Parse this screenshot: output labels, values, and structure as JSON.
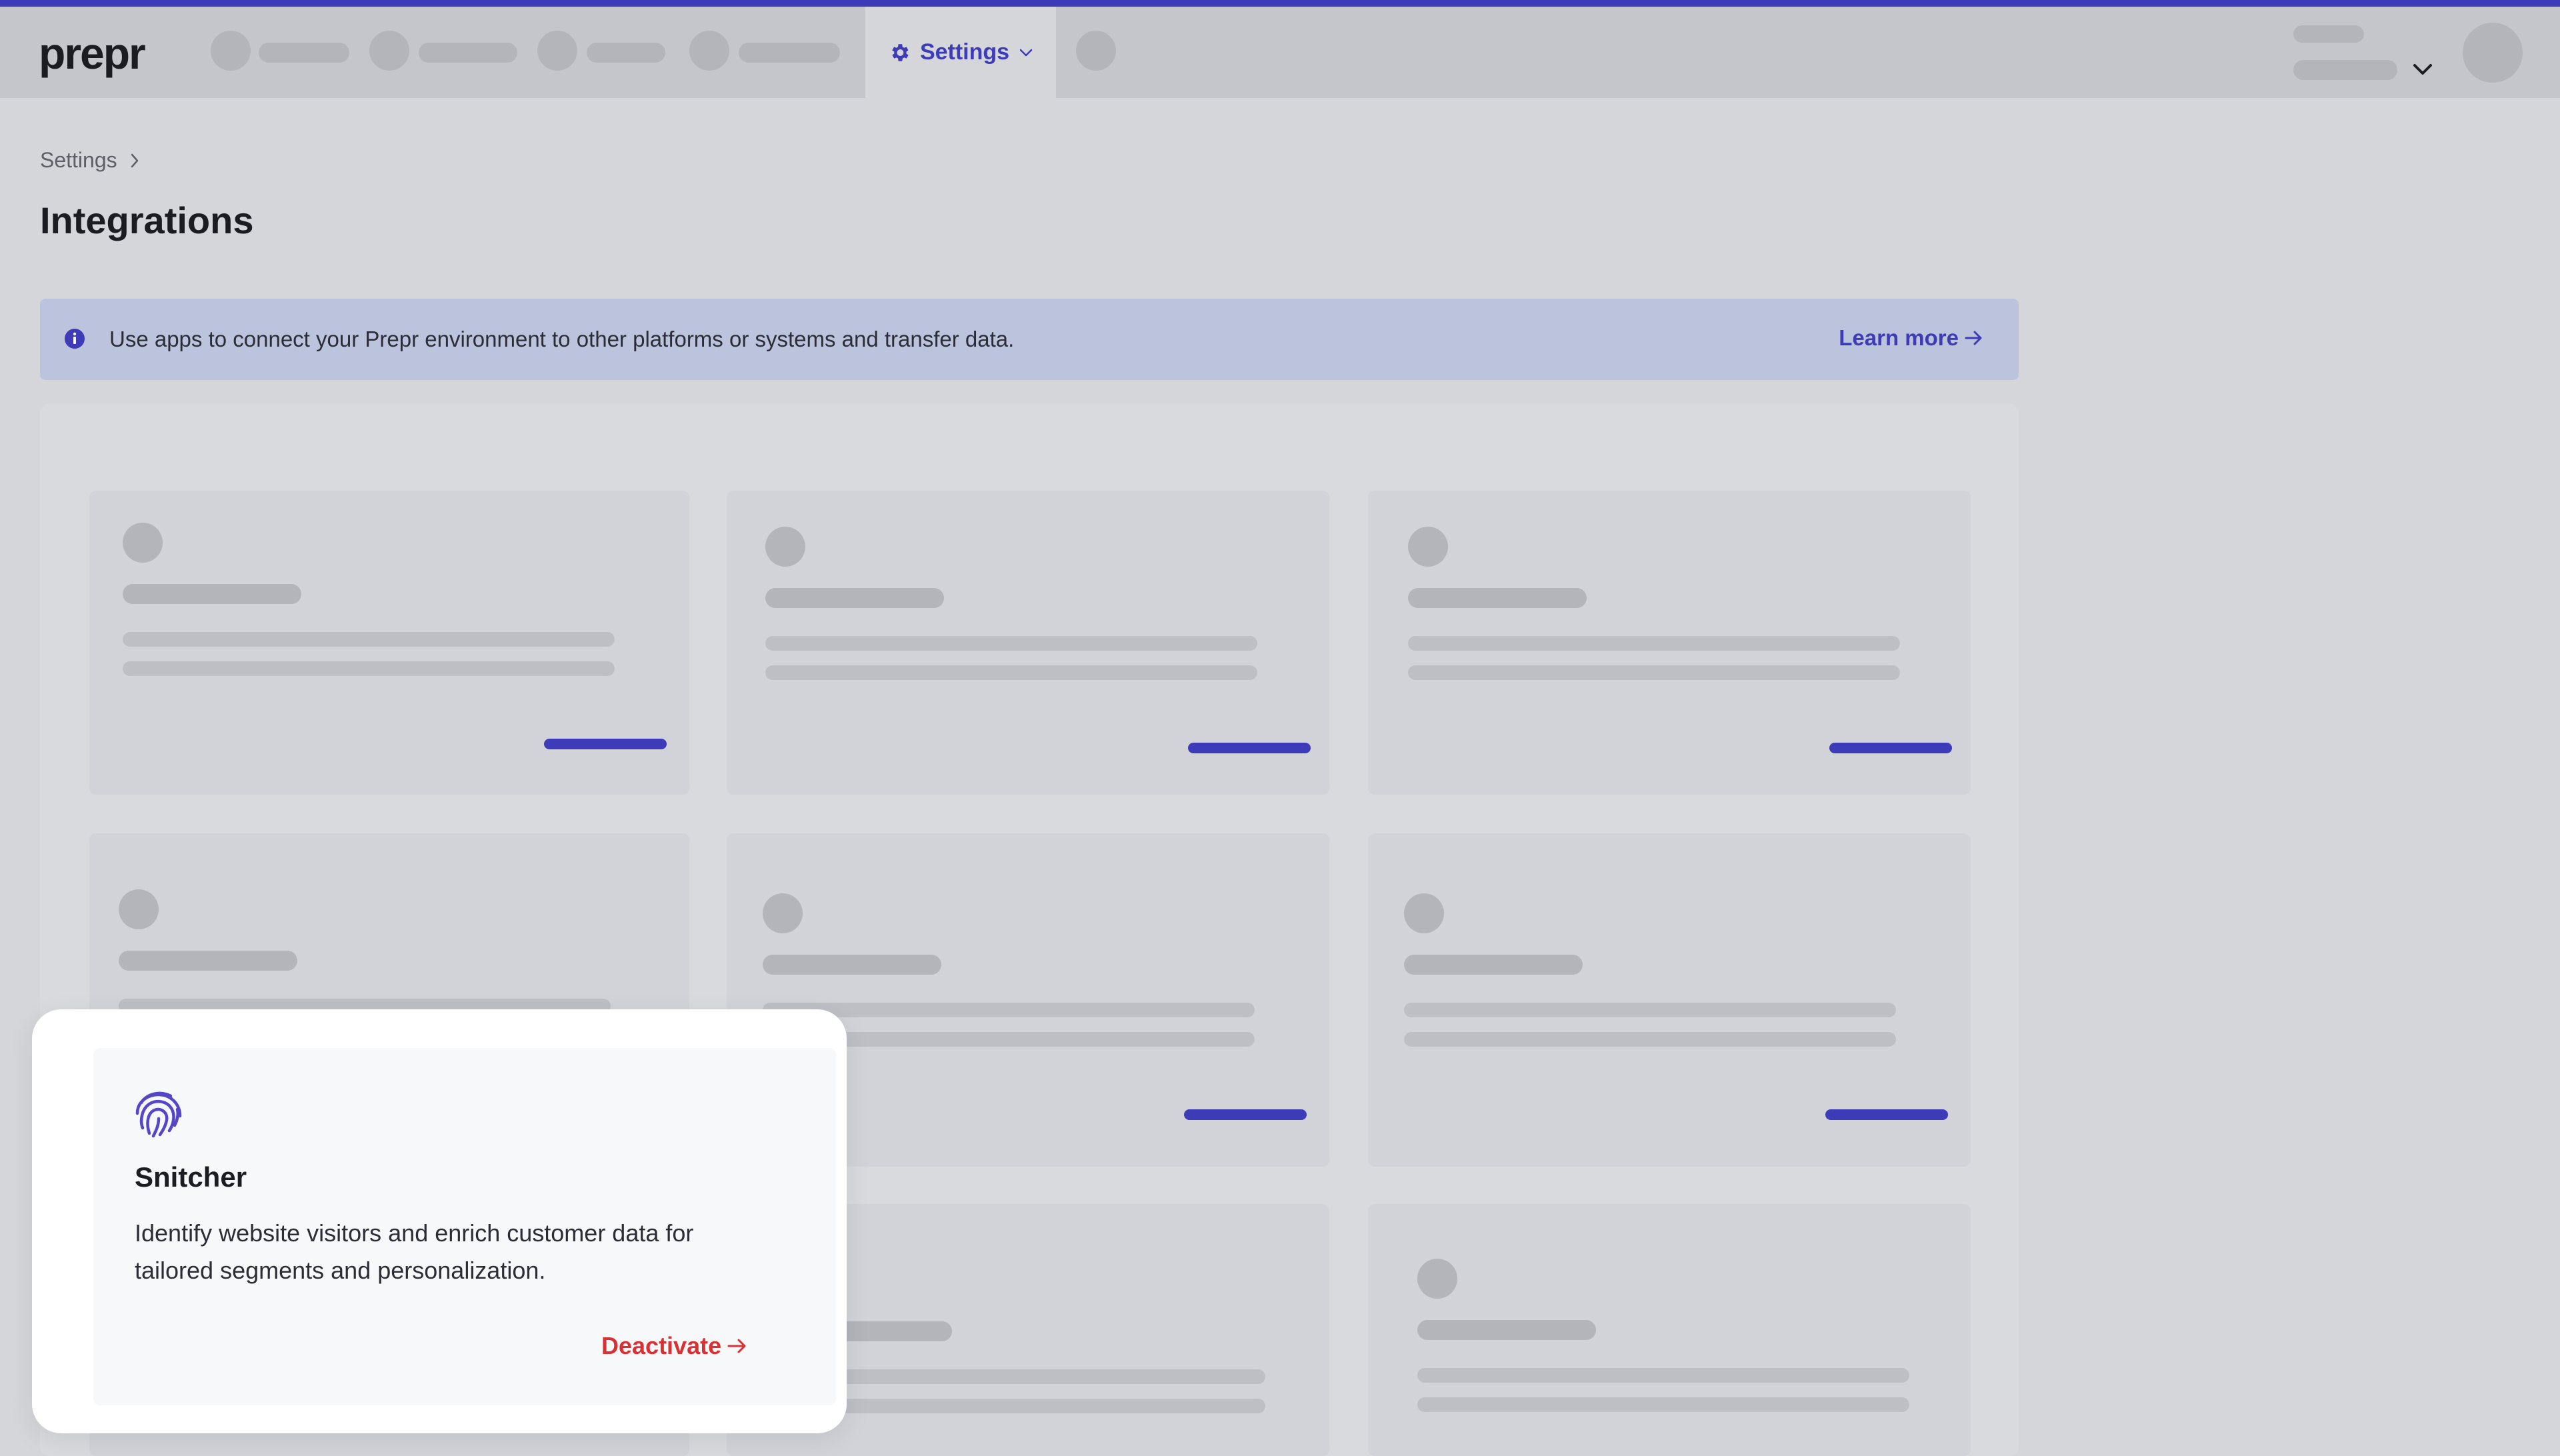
{
  "app": {
    "logo": "prepr"
  },
  "nav": {
    "settings_label": "Settings",
    "settings_icon": "gear-icon"
  },
  "breadcrumb": {
    "item": "Settings"
  },
  "page": {
    "title": "Integrations"
  },
  "info": {
    "text": "Use apps to connect your Prepr environment to other platforms or systems and transfer data.",
    "link": "Learn more"
  },
  "app_card": {
    "icon": "fingerprint-icon",
    "name": "Snitcher",
    "description": "Identify website visitors and enrich customer data for tailored segments and personalization.",
    "action": "Deactivate"
  },
  "colors": {
    "accent": "#3d3bb8",
    "danger": "#d93133"
  }
}
